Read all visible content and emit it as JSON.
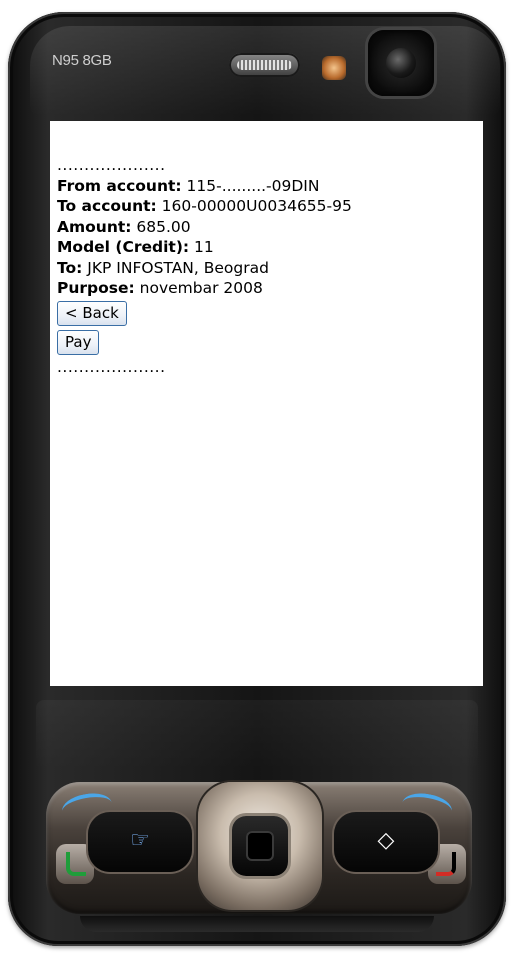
{
  "device": {
    "model_label": "N95 8GB"
  },
  "screen": {
    "dots_top": "....................",
    "rows": [
      {
        "label": "From account:",
        "value": " 115-.........-09DIN"
      },
      {
        "label": "To account:",
        "value": " 160-00000U0034655-95"
      },
      {
        "label": "Amount:",
        "value": " 685.00"
      },
      {
        "label": "Model (Credit):",
        "value": " 11"
      },
      {
        "label": "To:",
        "value": " JKP INFOSTAN, Beograd"
      },
      {
        "label": "Purpose:",
        "value": " novembar 2008"
      }
    ],
    "back_button": "< Back",
    "pay_button": "Pay",
    "dots_bottom": "...................."
  },
  "keys": {
    "left_soft_glyph": "☞",
    "right_soft_glyph": "◇"
  },
  "colors": {
    "button_border": "#3a6ea5",
    "call_green": "#1f9d3a",
    "end_red": "#d22c25",
    "soft_key_blue": "#4aa6e8"
  }
}
